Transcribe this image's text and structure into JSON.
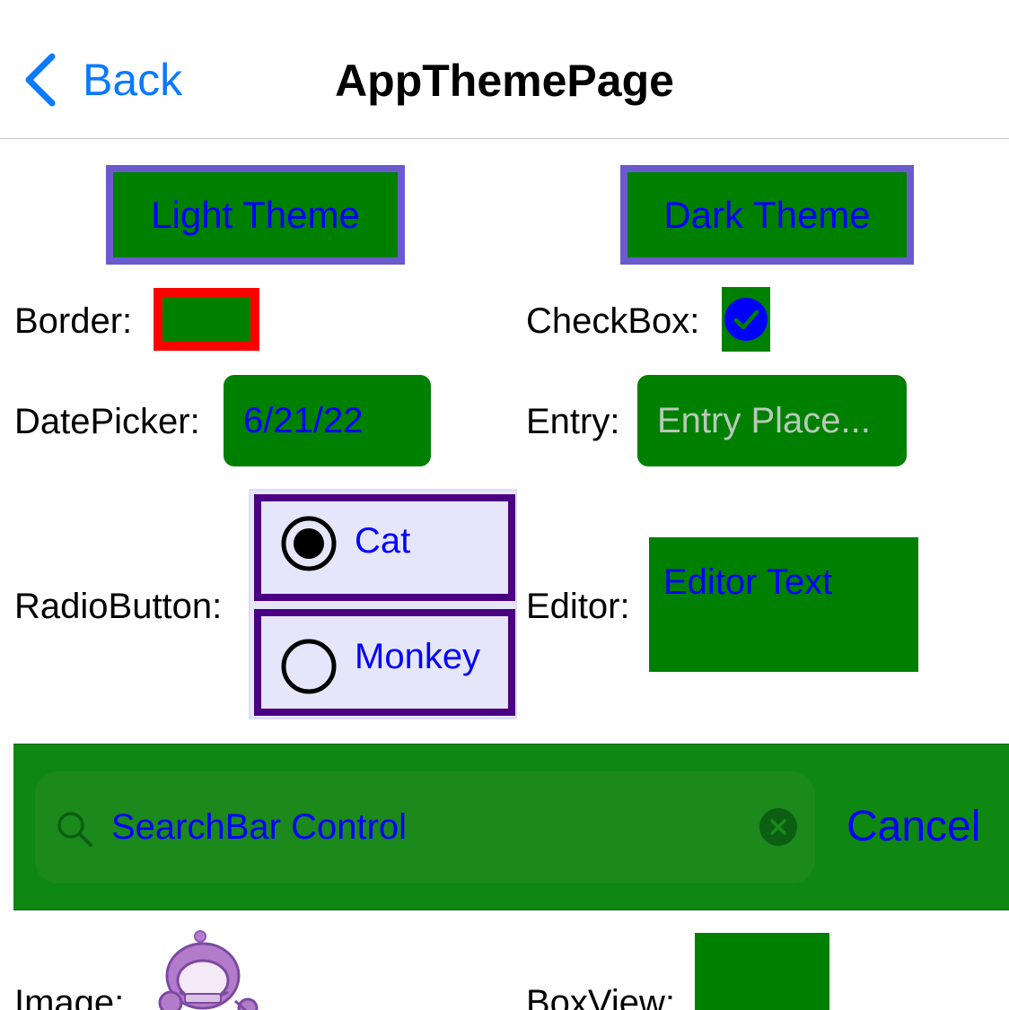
{
  "navbar": {
    "back_label": "Back",
    "title": "AppThemePage"
  },
  "theme_buttons": {
    "light": "Light Theme",
    "dark": "Dark Theme"
  },
  "controls": {
    "border_label": "Border:",
    "checkbox_label": "CheckBox:",
    "checkbox_checked": true,
    "datepicker_label": "DatePicker:",
    "datepicker_value": "6/21/22",
    "entry_label": "Entry:",
    "entry_placeholder": "Entry Place...",
    "radio_label": "RadioButton:",
    "radio_options": [
      {
        "label": "Cat",
        "selected": true
      },
      {
        "label": "Monkey",
        "selected": false
      }
    ],
    "editor_label": "Editor:",
    "editor_text": "Editor Text",
    "image_label": "Image:",
    "boxview_label": "BoxView:"
  },
  "searchbar": {
    "text": "SearchBar Control",
    "cancel_label": "Cancel",
    "search_icon": "search-icon",
    "clear_icon": "clear-icon"
  },
  "colors": {
    "accent_ios": "#0a7aff",
    "control_background": "#008000",
    "control_text": "#0000ff",
    "button_border": "#6a5acd",
    "border_stroke": "#ff0000",
    "radio_border": "#4b0082",
    "radio_background": "#e6e6fa"
  }
}
